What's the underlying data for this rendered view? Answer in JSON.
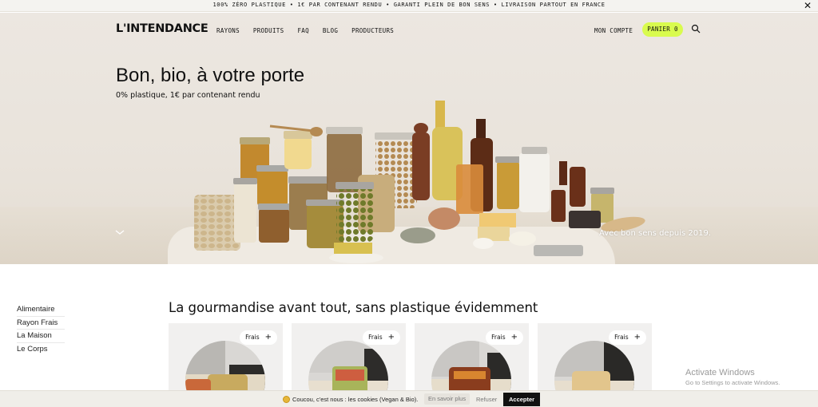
{
  "announcement": {
    "text": "100% ZÉRO PLASTIQUE • 1€ PAR CONTENANT RENDU • GARANTI PLEIN DE BON SENS • LIVRAISON PARTOUT EN FRANCE",
    "close_icon": "close-icon"
  },
  "header": {
    "logo": "L'INTENDANCE",
    "nav": [
      "RAYONS",
      "PRODUITS",
      "FAQ",
      "BLOG",
      "PRODUCTEURS"
    ],
    "account": "MON COMPTE",
    "cart": "PANIER 0",
    "search_icon": "search-icon",
    "accent_color": "#d9fb4e"
  },
  "hero": {
    "title": "Bon, bio, à votre porte",
    "subtitle": "0% plastique, 1€ par contenant rendu",
    "caption": "Avec bon sens depuis 2019.",
    "scroll_icon": "chevron-down-icon"
  },
  "sidebar": {
    "items": [
      "Alimentaire",
      "Rayon Frais",
      "La Maison",
      "Le Corps"
    ]
  },
  "section": {
    "title": "La gourmandise avant tout, sans plastique évidemment"
  },
  "products": [
    {
      "badge": "Frais",
      "action": "+"
    },
    {
      "badge": "Frais",
      "action": "+"
    },
    {
      "badge": "Frais",
      "action": "+"
    },
    {
      "badge": "Frais",
      "action": "+"
    }
  ],
  "watermark": {
    "title": "Activate Windows",
    "subtitle": "Go to Settings to activate Windows."
  },
  "cookie": {
    "text": "Coucou, c'est nous : les cookies (Vegan & Bio).",
    "more": "En savoir plus",
    "refuse": "Refuser",
    "accept": "Accepter"
  }
}
